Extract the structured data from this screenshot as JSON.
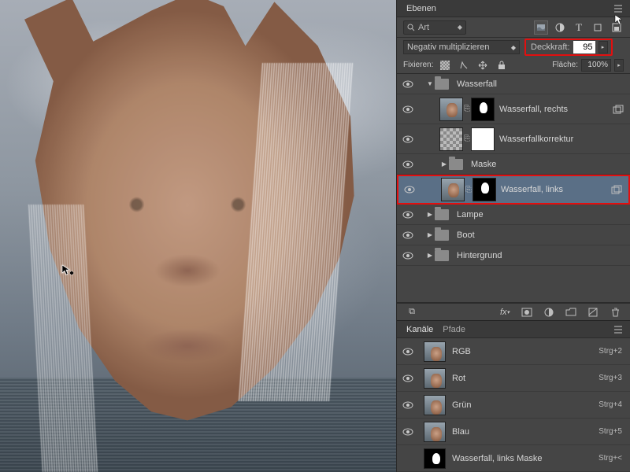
{
  "panels": {
    "layers_title": "Ebenen",
    "channels_title": "Kanäle",
    "paths_title": "Pfade"
  },
  "filter": {
    "search_placeholder": "Art",
    "filter_icons": [
      "image-filter-icon",
      "adjust-filter-icon",
      "type-filter-icon",
      "shape-filter-icon",
      "smart-filter-icon"
    ]
  },
  "blend": {
    "mode": "Negativ multiplizieren",
    "opacity_label": "Deckkraft:",
    "opacity_value": "95"
  },
  "lockrow": {
    "label": "Fixieren:",
    "fill_label": "Fläche:",
    "fill_value": "100%"
  },
  "layers": [
    {
      "type": "group",
      "name": "Wasserfall",
      "expanded": true,
      "depth": 0
    },
    {
      "type": "layer",
      "name": "Wasserfall, rechts",
      "thumb": "img",
      "mask": "mask-black",
      "depth": 1,
      "dup": true
    },
    {
      "type": "layer",
      "name": "Wasserfallkorrektur",
      "thumb": "checker",
      "mask": "mask",
      "depth": 1
    },
    {
      "type": "group",
      "name": "Maske",
      "expanded": false,
      "depth": 1
    },
    {
      "type": "layer",
      "name": "Wasserfall, links",
      "thumb": "img",
      "mask": "mask-black",
      "depth": 1,
      "selected": true,
      "dup": true
    },
    {
      "type": "group",
      "name": "Lampe",
      "expanded": false,
      "depth": 0
    },
    {
      "type": "group",
      "name": "Boot",
      "expanded": false,
      "depth": 0
    },
    {
      "type": "group",
      "name": "Hintergrund",
      "expanded": false,
      "depth": 0
    }
  ],
  "channels": [
    {
      "name": "RGB",
      "short": "Strg+2"
    },
    {
      "name": "Rot",
      "short": "Strg+3"
    },
    {
      "name": "Grün",
      "short": "Strg+4"
    },
    {
      "name": "Blau",
      "short": "Strg+5"
    },
    {
      "name": "Wasserfall, links Maske",
      "short": "Strg+<"
    }
  ]
}
